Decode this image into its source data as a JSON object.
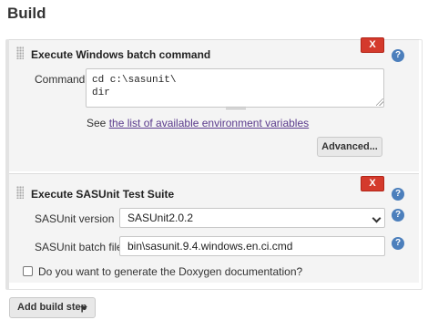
{
  "section": {
    "title": "Build"
  },
  "steps": [
    {
      "title": "Execute Windows batch command",
      "delete_label": "X",
      "command_label": "Command",
      "command_value": "cd c:\\sasunit\\\ndir",
      "env_prefix": "See ",
      "env_link": "the list of available environment variables",
      "advanced_label": "Advanced..."
    },
    {
      "title": "Execute SASUnit Test Suite",
      "delete_label": "X",
      "version_label": "SASUnit version",
      "version_value": "SASUnit2.0.2",
      "batch_label": "SASUnit batch file",
      "batch_value": "bin\\sasunit.9.4.windows.en.ci.cmd",
      "doxygen_label": "Do you want to generate the Doxygen documentation?",
      "doxygen_checked": false
    }
  ],
  "add_build_step": {
    "label": "Add build step"
  },
  "help_icon_glyph": "?",
  "icons": {
    "delete": "close-icon",
    "help": "help-icon",
    "dropdown": "chevron-down-icon",
    "drag": "drag-handle-icon"
  },
  "colors": {
    "delete_button": "#d43a2c",
    "help_icon": "#4c7fbc",
    "link": "#5a3a8c",
    "panel_background": "#f4f4f4"
  }
}
